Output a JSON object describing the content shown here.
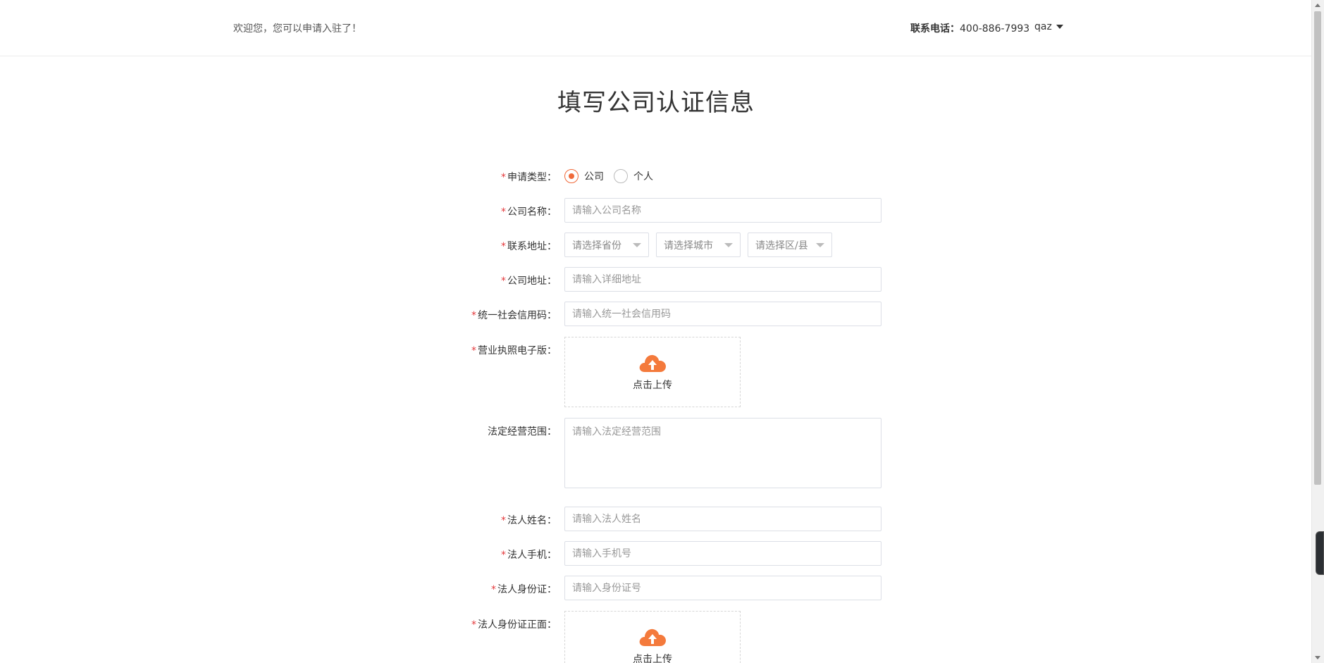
{
  "header": {
    "welcome": "欢迎您，您可以申请入驻了！",
    "contact_label": "联系电话：",
    "contact_phone": "400-886-7993",
    "username": "qaz"
  },
  "title": "填写公司认证信息",
  "form": {
    "apply_type": {
      "label": "申请类型：",
      "options": [
        "公司",
        "个人"
      ],
      "selected": "公司"
    },
    "company_name": {
      "label": "公司名称：",
      "placeholder": "请输入公司名称"
    },
    "contact_address": {
      "label": "联系地址：",
      "province": "请选择省份",
      "city": "请选择城市",
      "district": "请选择区/县"
    },
    "company_address": {
      "label": "公司地址：",
      "placeholder": "请输入详细地址"
    },
    "credit_code": {
      "label": "统一社会信用码：",
      "placeholder": "请输入统一社会信用码"
    },
    "business_license": {
      "label": "营业执照电子版：",
      "upload_text": "点击上传"
    },
    "business_scope": {
      "label": "法定经营范围：",
      "placeholder": "请输入法定经营范围"
    },
    "legal_name": {
      "label": "法人姓名：",
      "placeholder": "请输入法人姓名"
    },
    "legal_phone": {
      "label": "法人手机：",
      "placeholder": "请输入手机号"
    },
    "legal_id": {
      "label": "法人身份证：",
      "placeholder": "请输入身份证号"
    },
    "legal_id_front": {
      "label": "法人身份证正面：",
      "upload_text": "点击上传"
    }
  },
  "colors": {
    "accent": "#f06a3a",
    "required": "#e4393c",
    "border": "#dcdfe6"
  }
}
